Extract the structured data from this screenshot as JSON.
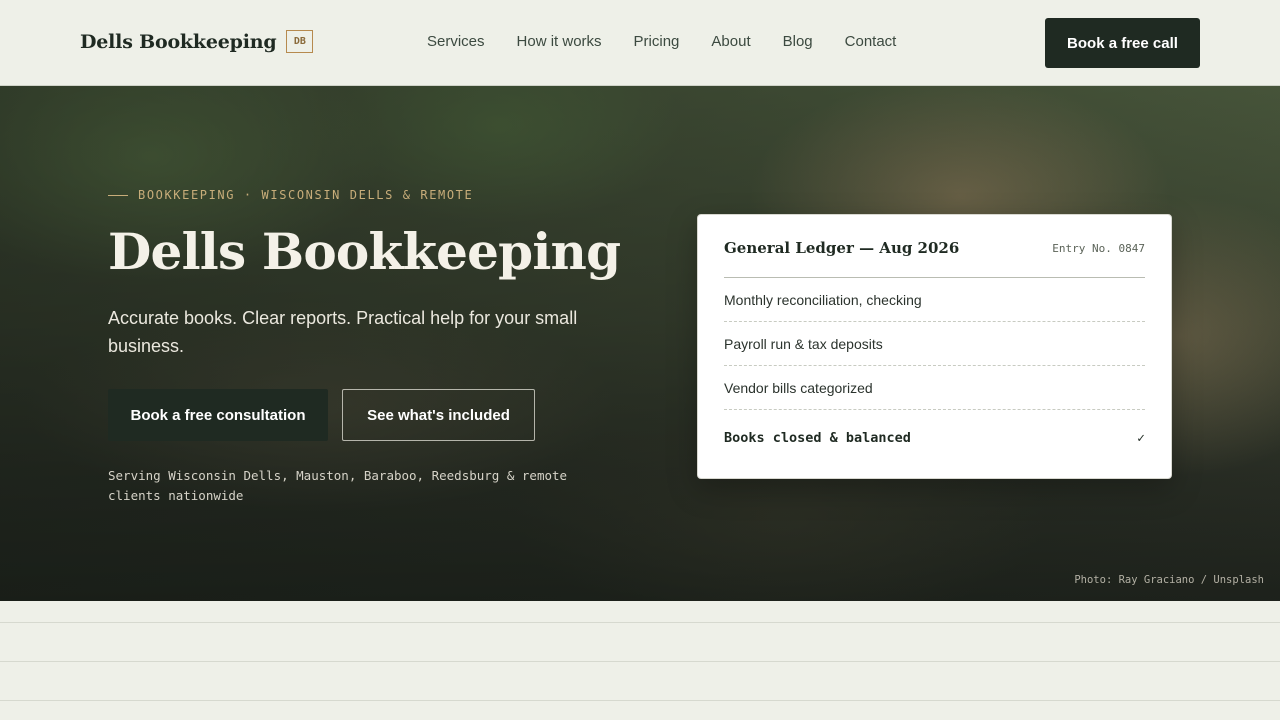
{
  "header": {
    "brand_name": "Dells Bookkeeping",
    "brand_mark": "DB",
    "nav": [
      "Services",
      "How it works",
      "Pricing",
      "About",
      "Blog",
      "Contact"
    ],
    "cta": "Book a free call"
  },
  "hero": {
    "eyebrow": "BOOKKEEPING · WISCONSIN DELLS & REMOTE",
    "title": "Dells Bookkeeping",
    "subtitle": "Accurate books. Clear reports. Practical help for your small business.",
    "primary_button": "Book a free consultation",
    "secondary_button": "See what's included",
    "serving": "Serving Wisconsin Dells, Mauston, Baraboo, Reedsburg & remote clients nationwide",
    "photo_credit": "Photo: Ray Graciano / Unsplash"
  },
  "ledger": {
    "title": "General Ledger — Aug 2026",
    "entry": "Entry No. 0847",
    "rows": [
      "Monthly reconciliation, checking",
      "Payroll run & tax deposits",
      "Vendor bills categorized"
    ],
    "final_row": "Books closed & balanced",
    "final_mark": "✓"
  }
}
